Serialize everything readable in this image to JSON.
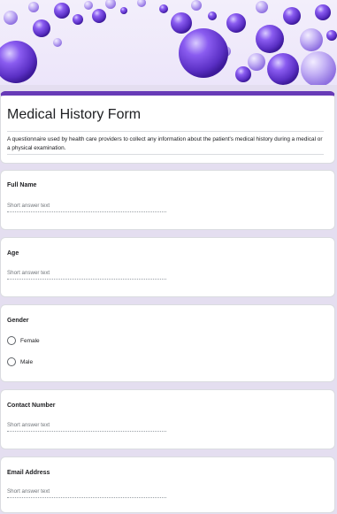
{
  "header": {
    "image_name": "purple-spheres-banner"
  },
  "form": {
    "title": "Medical History Form",
    "description": "A questionnaire used by health care providers to collect any information about the patient's medical history during a medical or a physical examination.",
    "accent_color": "#673ab7"
  },
  "questions": [
    {
      "label": "Full Name",
      "type": "short",
      "placeholder": "Short answer text"
    },
    {
      "label": "Age",
      "type": "short",
      "placeholder": "Short answer text"
    },
    {
      "label": "Gender",
      "type": "radio",
      "options": [
        "Female",
        "Male"
      ]
    },
    {
      "label": "Contact Number",
      "type": "short",
      "placeholder": "Short answer text"
    },
    {
      "label": "Email Address",
      "type": "short",
      "placeholder": "Short answer text"
    }
  ],
  "colors": {
    "background": "#e4def0",
    "card": "#ffffff",
    "sphere_primary": "#6a3fd0",
    "sphere_light": "#b9a4ee"
  }
}
